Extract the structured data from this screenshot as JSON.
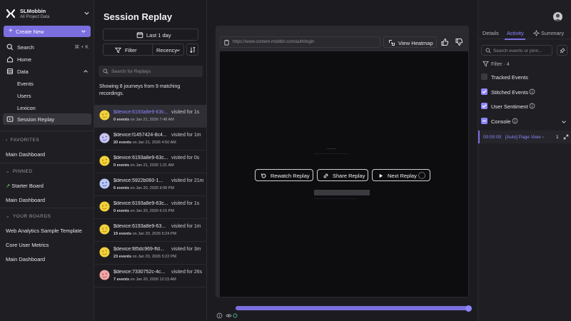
{
  "org": {
    "name": "SLMobbin",
    "subtitle": "All Project Data"
  },
  "sidebar": {
    "create_label": "Create New",
    "nav": [
      {
        "label": "Search",
        "shortcut": "⌘ + K",
        "icon": "search-icon"
      },
      {
        "label": "Home",
        "icon": "home-icon"
      },
      {
        "label": "Data",
        "icon": "database-icon"
      },
      {
        "label": "Events"
      },
      {
        "label": "Users"
      },
      {
        "label": "Lexicon"
      },
      {
        "label": "Session Replay",
        "icon": "replay-icon",
        "active": true
      }
    ],
    "favorites_title": "FAVORITES",
    "favorites": [
      "Main Dashboard"
    ],
    "pinned_title": "PINNED",
    "pinned": [
      "Starter Board",
      "Main Dashboard"
    ],
    "boards_title": "YOUR BOARDS",
    "boards": [
      "Web Analytics Sample Template",
      "Core User Metrics",
      "Main Dashboard"
    ]
  },
  "list": {
    "title": "Session Replay",
    "date_label": "Last 1 day",
    "filter_label": "Filter",
    "sort_label": "Recency",
    "search_placeholder": "Search for Replays",
    "showing_text": "Showing 8 journeys from 9 matching recordings.",
    "rows": [
      {
        "device": "$device:6193a8e9-63c...",
        "visited": "visited for 1s",
        "events": "0 events",
        "date": "on Jan 21, 2026 7:48 AM",
        "avatar": "yellow",
        "selected": true
      },
      {
        "device": "$device:f1457424-8c4...",
        "visited": "visited for 1m",
        "events": "20 events",
        "date": "on Jan 21, 2026 4:50 AM",
        "avatar": "lavender"
      },
      {
        "device": "$device:6193a8e9-63c...",
        "visited": "visited for 0s",
        "events": "0 events",
        "date": "on Jan 21, 2026 1:21 AM",
        "avatar": "yellow"
      },
      {
        "device": "$device:5922b060-1...",
        "visited": "visited for 21m",
        "events": "6 events",
        "date": "on Jan 20, 2026 9:08 PM",
        "avatar": "blue"
      },
      {
        "device": "$device:6193a8e9-63c...",
        "visited": "visited for 1s",
        "events": "0 events",
        "date": "on Jan 20, 2026 6:15 PM",
        "avatar": "yellow"
      },
      {
        "device": "$device:6193a8e9-63...",
        "visited": "visited for 1m",
        "events": "19 events",
        "date": "on Jan 20, 2026 5:24 PM",
        "avatar": "yellow"
      },
      {
        "device": "$device:f85dc969-ffd...",
        "visited": "visited for 3m",
        "events": "23 events",
        "date": "on Jan 20, 2026 5:22 PM",
        "avatar": "yellow"
      },
      {
        "device": "$device:7330752c-4c...",
        "visited": "visited for 26s",
        "events": "7 events",
        "date": "on Jan 20, 2026 12:15 AM",
        "avatar": "pink"
      }
    ]
  },
  "player": {
    "url": "https://www.content-mobbin.com/auth/login",
    "heatmap_label": "View Heatmap",
    "rewatch_label": "Rewatch Replay",
    "share_label": "Share Replay",
    "next_label": "Next Replay",
    "progress": 1.0
  },
  "right": {
    "tabs": [
      "Details",
      "Activity",
      "Summary"
    ],
    "active_tab": "Activity",
    "search_placeholder": "Search events or pinn...",
    "filter_label": "Filter · 4",
    "checks": [
      {
        "label": "Tracked Events",
        "checked": false,
        "info": false
      },
      {
        "label": "Stitched Events",
        "checked": true,
        "info": true
      },
      {
        "label": "User Sentiment",
        "checked": true,
        "info": true
      },
      {
        "label": "Console",
        "checked": true,
        "info": true,
        "partial": true
      }
    ],
    "event": {
      "time": "00:00:00",
      "name": "[Auto] Page View",
      "count": "1"
    }
  },
  "colors": {
    "accent": "#7b6fe0",
    "accent_light": "#8f86ff",
    "bg": "#1c1c20",
    "viewport": "#0d0d0f"
  }
}
